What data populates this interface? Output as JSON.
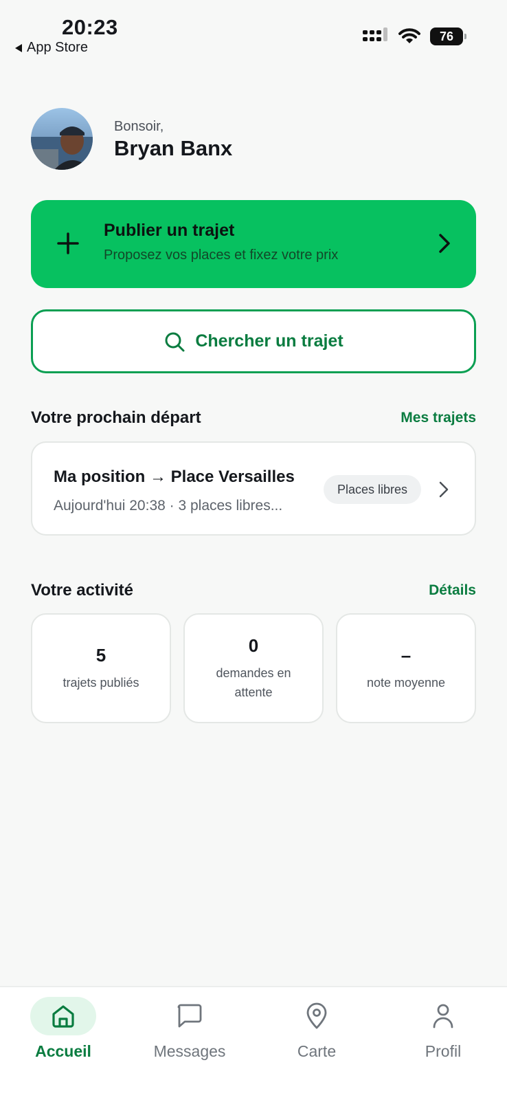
{
  "status_bar": {
    "time": "20:23",
    "back_label": "App Store",
    "battery": "76",
    "icons": [
      "cellular-signal-icon",
      "wifi-icon",
      "battery-icon"
    ]
  },
  "header": {
    "greeting": "Bonsoir,",
    "user_name": "Bryan Banx"
  },
  "publish_card": {
    "title": "Publier un trajet",
    "subtitle": "Proposez vos places et fixez votre prix",
    "icon": "plus-icon"
  },
  "search_button": {
    "label": "Chercher un trajet",
    "icon": "search-icon"
  },
  "next_departure": {
    "section_title": "Votre prochain départ",
    "link": "Mes trajets",
    "route": "Ma position → Place Versailles",
    "details": "Aujourd'hui 20:38 · 3 places libres...",
    "badge": "Places libres"
  },
  "activity": {
    "section_title": "Votre activité",
    "link": "Détails",
    "stats": [
      {
        "value": "5",
        "label": "trajets publiés"
      },
      {
        "value": "0",
        "label": "demandes en attente"
      },
      {
        "value": "–",
        "label": "note moyenne"
      }
    ]
  },
  "tab_bar": {
    "tabs": [
      {
        "label": "Accueil",
        "icon": "home-icon",
        "active": true
      },
      {
        "label": "Messages",
        "icon": "message-icon",
        "active": false
      },
      {
        "label": "Carte",
        "icon": "map-pin-icon",
        "active": false
      },
      {
        "label": "Profil",
        "icon": "user-icon",
        "active": false
      }
    ]
  },
  "colors": {
    "accent": "#07c160",
    "accent_dark": "#0a7c40",
    "background": "#f7f8f7"
  }
}
